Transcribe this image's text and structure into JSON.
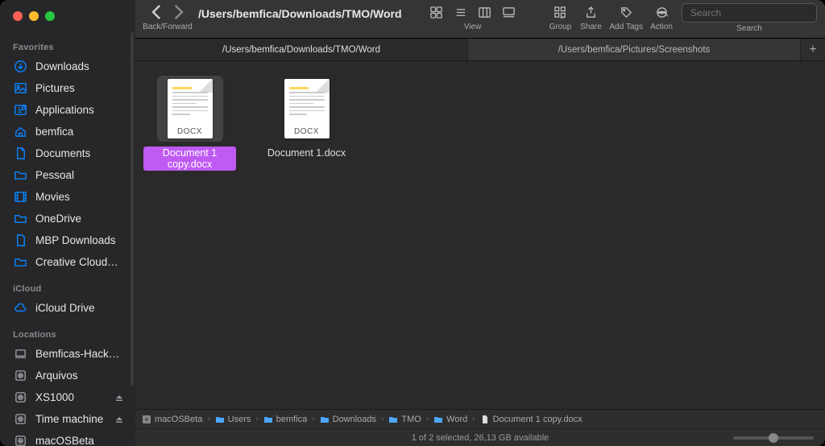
{
  "toolbar": {
    "back_forward_label": "Back/Forward",
    "path_title": "/Users/bemfica/Downloads/TMO/Word",
    "view_label": "View",
    "group_label": "Group",
    "share_label": "Share",
    "add_tags_label": "Add Tags",
    "action_label": "Action",
    "search_label": "Search",
    "search_placeholder": "Search"
  },
  "tabs": [
    {
      "label": "/Users/bemfica/Downloads/TMO/Word",
      "active": true
    },
    {
      "label": "/Users/bemfica/Pictures/Screenshots",
      "active": false
    }
  ],
  "sidebar": {
    "section_favorites": "Favorites",
    "favorites": [
      {
        "label": "Downloads",
        "icon": "download"
      },
      {
        "label": "Pictures",
        "icon": "pictures"
      },
      {
        "label": "Applications",
        "icon": "apps"
      },
      {
        "label": "bemfica",
        "icon": "home"
      },
      {
        "label": "Documents",
        "icon": "docs"
      },
      {
        "label": "Pessoal",
        "icon": "folder"
      },
      {
        "label": "Movies",
        "icon": "movies"
      },
      {
        "label": "OneDrive",
        "icon": "folder"
      },
      {
        "label": "MBP Downloads",
        "icon": "file"
      },
      {
        "label": "Creative Cloud…",
        "icon": "folder"
      }
    ],
    "section_icloud": "iCloud",
    "icloud": [
      {
        "label": "iCloud Drive",
        "icon": "cloud"
      }
    ],
    "section_locations": "Locations",
    "locations": [
      {
        "label": "Bemficas-Hack…",
        "icon": "laptop",
        "eject": false
      },
      {
        "label": "Arquivos",
        "icon": "disk",
        "eject": false
      },
      {
        "label": "XS1000",
        "icon": "disk",
        "eject": true
      },
      {
        "label": "Time machine",
        "icon": "disk",
        "eject": true
      },
      {
        "label": "macOSBeta",
        "icon": "disk",
        "eject": false
      }
    ]
  },
  "files": [
    {
      "name": "Document 1 copy.docx",
      "ext": "DOCX",
      "selected": true
    },
    {
      "name": "Document 1.docx",
      "ext": "DOCX",
      "selected": false
    }
  ],
  "pathbar": [
    {
      "label": "macOSBeta",
      "icon": "disk"
    },
    {
      "label": "Users",
      "icon": "folder"
    },
    {
      "label": "bemfica",
      "icon": "folder"
    },
    {
      "label": "Downloads",
      "icon": "folder"
    },
    {
      "label": "TMO",
      "icon": "folder"
    },
    {
      "label": "Word",
      "icon": "folder"
    },
    {
      "label": "Document 1 copy.docx",
      "icon": "doc"
    }
  ],
  "status": "1 of 2 selected, 26,13 GB available"
}
